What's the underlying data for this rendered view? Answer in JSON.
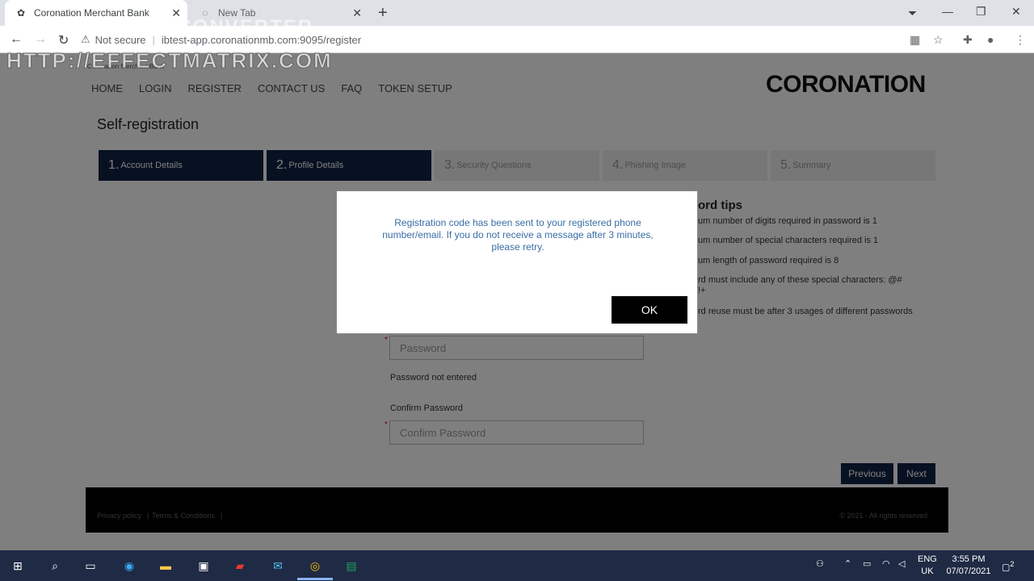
{
  "browser": {
    "tabs": [
      {
        "title": "Coronation Merchant Bank",
        "active": true
      },
      {
        "title": "New Tab",
        "active": false
      }
    ],
    "new_tab_glyph": "+",
    "url_warning": "Not secure",
    "url": "ibtest-app.coronationmb.com:9095/register",
    "window_controls": {
      "minimize": "—",
      "restore": "❐",
      "close": "✕"
    }
  },
  "watermark": {
    "line1": "TOTAL VIDEO CONVERTER",
    "line2": "HTTP://EFFECTMATRIX.COM"
  },
  "site": {
    "breadcrumb": "Coronation Merchant Bank",
    "logo": "CORONATION",
    "nav": [
      "HOME",
      "LOGIN",
      "REGISTER",
      "CONTACT US",
      "FAQ",
      "TOKEN SETUP"
    ],
    "page_title": "Self-registration",
    "steps": [
      {
        "num": "1.",
        "label": "Account Details",
        "done": true
      },
      {
        "num": "2.",
        "label": "Profile Details",
        "done": true
      },
      {
        "num": "3.",
        "label": "Security Questions",
        "done": false
      },
      {
        "num": "4.",
        "label": "Phishing Image",
        "done": false
      },
      {
        "num": "5.",
        "label": "Summary",
        "done": false
      }
    ],
    "tips_title": "ord tips",
    "tips": [
      "um number of digits required in password is 1",
      "um number of special characters required is 1",
      "um length of password required is 8",
      "rd must include any of these special characters: @#\n!+",
      "rd reuse must be after 3 usages of different passwords"
    ],
    "password_placeholder": "Password",
    "password_error": "Password not entered",
    "confirm_label": "Confirm Password",
    "confirm_placeholder": "Confirm Password",
    "previous_label": "Previous",
    "next_label": "Next",
    "footer_links": [
      "Privacy policy",
      "Terms & Conditions"
    ],
    "footer_copy": "© 2021 - All rights reserved"
  },
  "modal": {
    "message": "Registration code has been sent to your registered phone number/email. If you do not receive a message after 3 minutes, please retry.",
    "ok_label": "OK"
  },
  "taskbar": {
    "lang": "ENG",
    "region": "UK",
    "time": "3:55 PM",
    "date": "07/07/2021",
    "notification_count": "2"
  },
  "colors": {
    "step_active": "#0e2244",
    "modal_text": "#3a6ea5",
    "taskbar": "#1f2a44"
  }
}
